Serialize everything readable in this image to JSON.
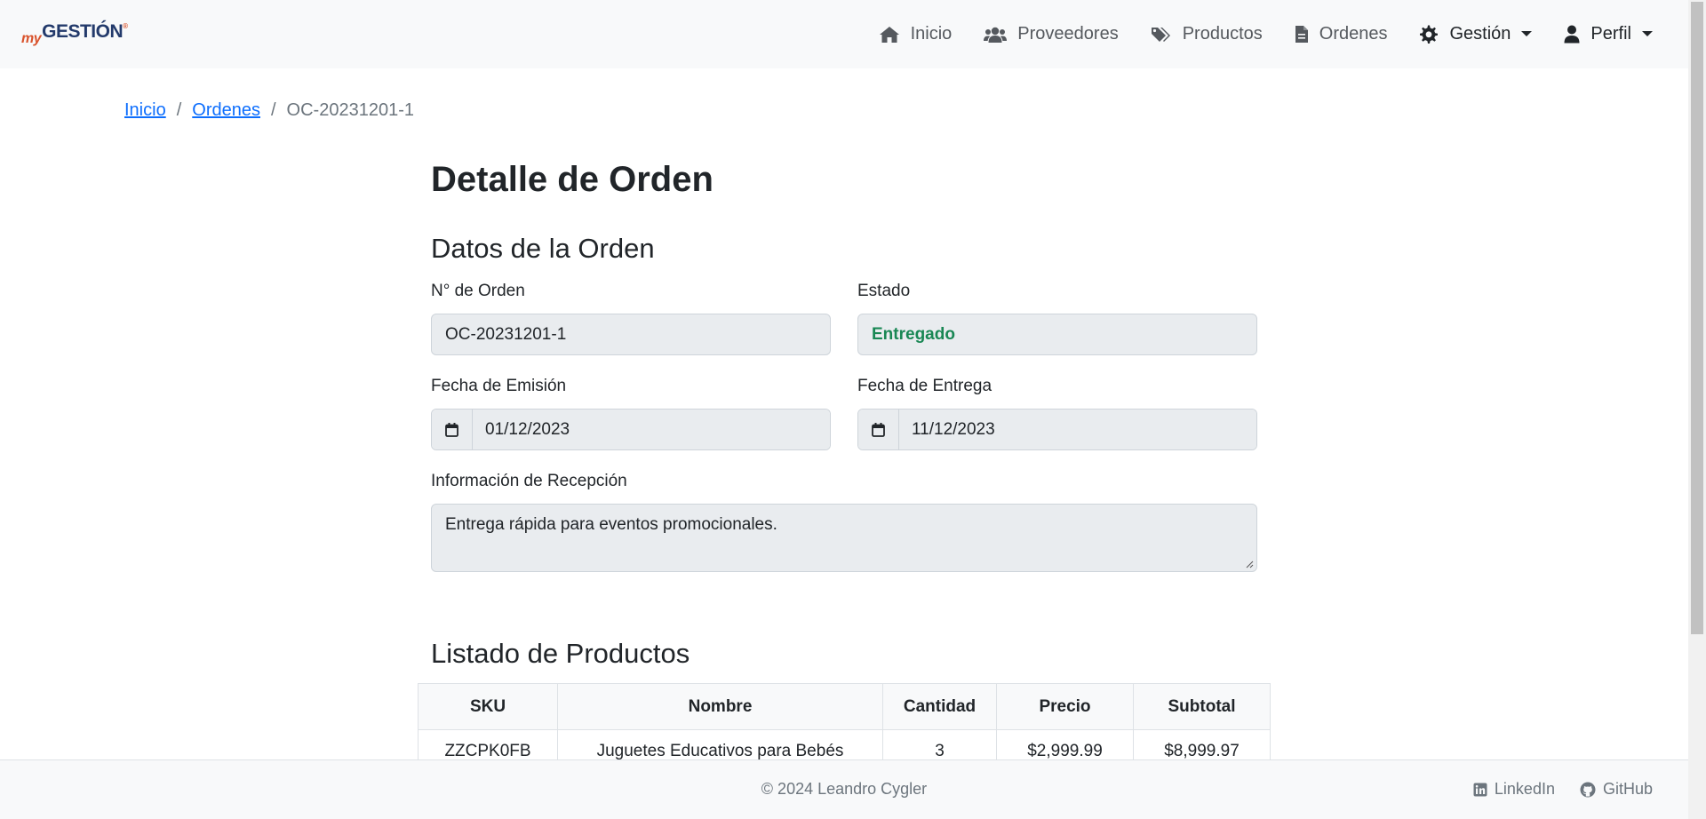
{
  "brand": {
    "prefix": "my",
    "name": "GESTIÓN",
    "mark": "®"
  },
  "nav": {
    "inicio": "Inicio",
    "proveedores": "Proveedores",
    "productos": "Productos",
    "ordenes": "Ordenes",
    "gestion": "Gestión",
    "perfil": "Perfil"
  },
  "breadcrumb": {
    "home": "Inicio",
    "ordenes": "Ordenes",
    "current": "OC-20231201-1"
  },
  "page": {
    "title": "Detalle de Orden"
  },
  "order": {
    "section_title": "Datos de la Orden",
    "number_label": "N° de Orden",
    "number": "OC-20231201-1",
    "status_label": "Estado",
    "status": "Entregado",
    "status_color": "#198754",
    "issue_date_label": "Fecha de Emisión",
    "issue_date": "01/12/2023",
    "delivery_date_label": "Fecha de Entrega",
    "delivery_date": "11/12/2023",
    "reception_label": "Información de Recepción",
    "reception": "Entrega rápida para eventos promocionales."
  },
  "products": {
    "section_title": "Listado de Productos",
    "headers": [
      "SKU",
      "Nombre",
      "Cantidad",
      "Precio",
      "Subtotal"
    ],
    "rows": [
      [
        "ZZCPK0FB",
        "Juguetes Educativos para Bebés",
        "3",
        "$2,999.99",
        "$8,999.97"
      ]
    ]
  },
  "footer": {
    "copyright": "© 2024 Leandro Cygler",
    "linkedin": "LinkedIn",
    "github": "GitHub"
  },
  "colors": {
    "link": "#0d6efd",
    "brand_orange": "#d9532c",
    "brand_navy": "#233a6b"
  }
}
